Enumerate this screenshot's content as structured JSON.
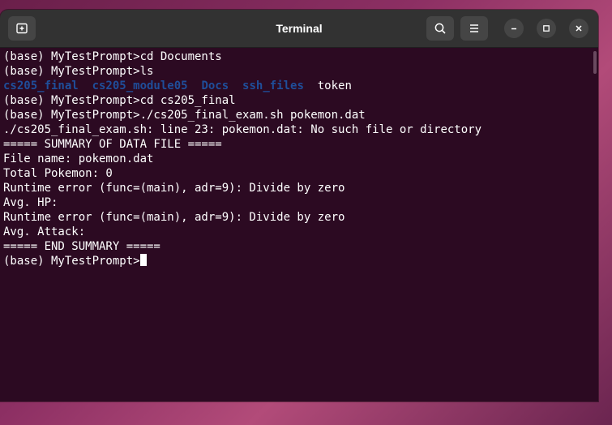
{
  "window": {
    "title": "Terminal"
  },
  "header": {
    "new_tab_icon": "new-tab-icon",
    "search_icon": "search-icon",
    "menu_icon": "hamburger-menu-icon",
    "minimize_icon": "minimize-icon",
    "maximize_icon": "maximize-icon",
    "close_icon": "close-icon"
  },
  "colors": {
    "terminal_bg": "#2c0a22",
    "directory_text": "#1f4e9a",
    "text": "#ffffff",
    "titlebar": "#323232"
  },
  "terminal": {
    "lines": [
      "(base) MyTestPrompt>cd Documents",
      "(base) MyTestPrompt>ls",
      null,
      "(base) MyTestPrompt>cd cs205_final",
      "(base) MyTestPrompt>./cs205_final_exam.sh pokemon.dat",
      "./cs205_final_exam.sh: line 23: pokemon.dat: No such file or directory",
      "===== SUMMARY OF DATA FILE =====",
      "File name: pokemon.dat",
      "Total Pokemon: 0",
      "Runtime error (func=(main), adr=9): Divide by zero",
      "Avg. HP:",
      "Runtime error (func=(main), adr=9): Divide by zero",
      "Avg. Attack:",
      "===== END SUMMARY =====",
      "(base) MyTestPrompt>"
    ],
    "ls_output": [
      {
        "name": "cs205_final",
        "type": "dir"
      },
      {
        "name": "cs205_module05",
        "type": "dir"
      },
      {
        "name": "Docs",
        "type": "dir"
      },
      {
        "name": "ssh_files",
        "type": "dir"
      },
      {
        "name": "token",
        "type": "file"
      }
    ]
  }
}
